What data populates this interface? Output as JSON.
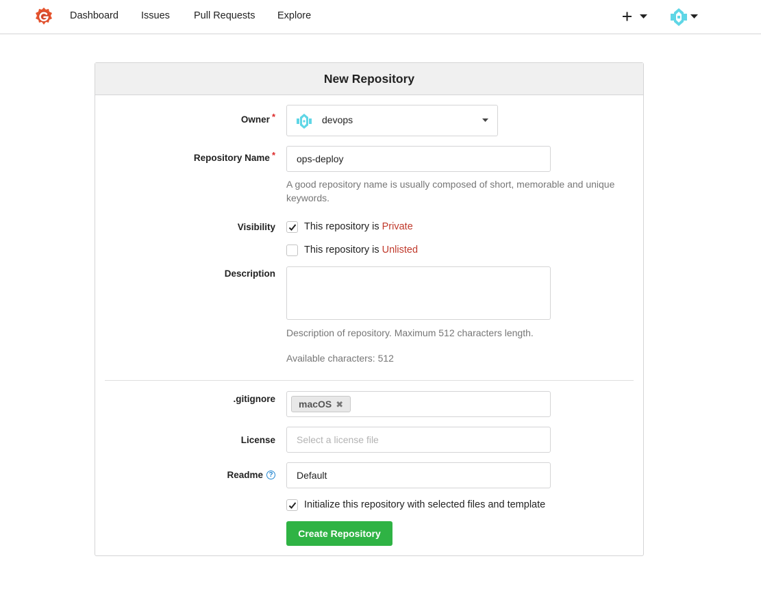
{
  "nav": {
    "logo_icon": "gitea-logo-icon",
    "links": [
      "Dashboard",
      "Issues",
      "Pull Requests",
      "Explore"
    ],
    "plus_icon": "plus-icon",
    "avatar_icon": "user-avatar-icon"
  },
  "form": {
    "title": "New Repository",
    "owner": {
      "label": "Owner",
      "required": "*",
      "value": "devops",
      "avatar_icon": "org-avatar-icon"
    },
    "repo_name": {
      "label": "Repository Name",
      "required": "*",
      "value": "ops-deploy",
      "help": "A good repository name is usually composed of short, memorable and unique keywords."
    },
    "visibility": {
      "label": "Visibility",
      "private": {
        "checked": true,
        "text": "This repository is ",
        "emphasis": "Private"
      },
      "unlisted": {
        "checked": false,
        "text": "This repository is ",
        "emphasis": "Unlisted"
      }
    },
    "description": {
      "label": "Description",
      "value": "",
      "help": "Description of repository. Maximum 512 characters length.",
      "available": "Available characters: 512"
    },
    "gitignore": {
      "label": ".gitignore",
      "tags": [
        "macOS"
      ],
      "remove_glyph": "✖"
    },
    "license": {
      "label": "License",
      "placeholder": "Select a license file"
    },
    "readme": {
      "label": "Readme",
      "help_glyph": "?",
      "value": "Default"
    },
    "init": {
      "checked": true,
      "text": "Initialize this repository with selected files and template"
    },
    "submit_label": "Create Repository"
  },
  "colors": {
    "accent_red": "#c0392b",
    "button_green": "#2fb344",
    "logo_orange": "#e5532d",
    "avatar_teal": "#4fd1e0"
  }
}
